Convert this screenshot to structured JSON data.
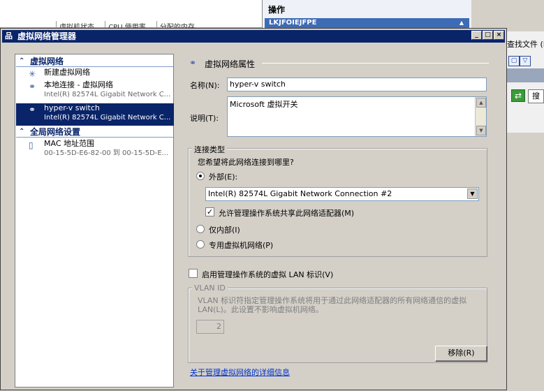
{
  "background": {
    "columns": [
      "虚拟机状态",
      "CPU 使用率",
      "分配的内存"
    ],
    "ops_title": "操作",
    "ops_item": "LKJFOIEJFPE",
    "right_text": "查找文件 (F",
    "right_button": "搜"
  },
  "window": {
    "title": "虚拟网络管理器"
  },
  "left": {
    "section1": "虚拟网络",
    "section2": "全局网络设置",
    "items": [
      {
        "title": "新建虚拟网络",
        "sub": ""
      },
      {
        "title": "本地连接 - 虚拟网络",
        "sub": "Intel(R) 82574L Gigabit Network C..."
      },
      {
        "title": "hyper-v switch",
        "sub": "Intel(R) 82574L Gigabit Network C..."
      }
    ],
    "global_items": [
      {
        "title": "MAC 地址范围",
        "sub": "00-15-5D-E6-82-00 到 00-15-5D-E..."
      }
    ]
  },
  "props": {
    "group_title": "虚拟网络属性",
    "name_label": "名称(N):",
    "name_value": "hyper-v switch",
    "desc_label": "说明(T):",
    "desc_value": "Microsoft 虚拟开关",
    "conn_type": "连接类型",
    "conn_question": "您希望将此网络连接到哪里?",
    "external": "外部(E):",
    "adapter": "Intel(R) 82574L Gigabit Network Connection #2",
    "allow_share": "允许管理操作系统共享此网络适配器(M)",
    "internal_only": "仅内部(I)",
    "private": "专用虚拟机网络(P)",
    "vlan_enable": "启用管理操作系统的虚拟 LAN 标识(V)",
    "vlan_id_title": "VLAN ID",
    "vlan_desc": "VLAN 标识符指定管理操作系统将用于通过此网络适配器的所有网络通信的虚拟 LAN(L)。此设置不影响虚拟机网络。",
    "vlan_value": "2",
    "remove": "移除(R)",
    "more_info": "关于管理虚拟网络的详细信息"
  }
}
